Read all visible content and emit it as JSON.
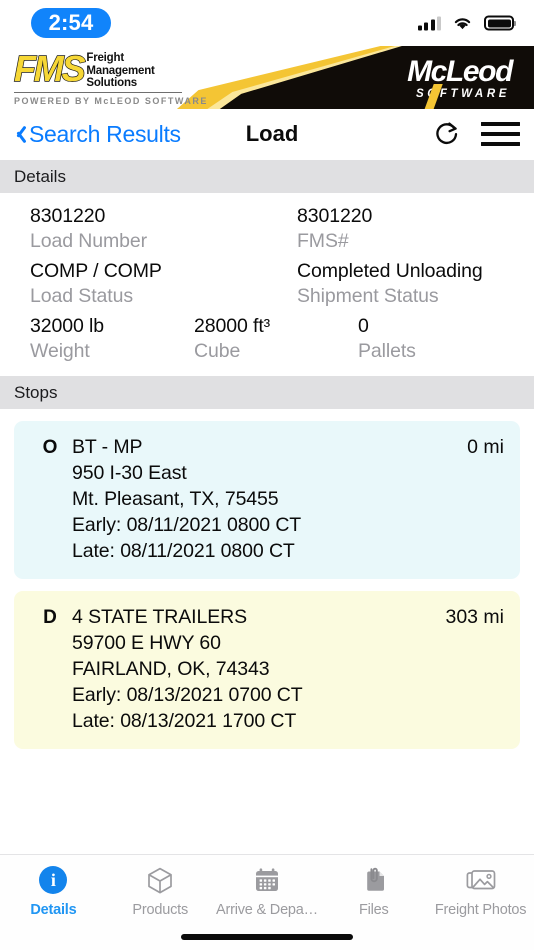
{
  "status_bar": {
    "time": "2:54",
    "time_pill_color": "#1184fb",
    "signal_icon": "cellular-signal-icon",
    "wifi_icon": "wifi-icon",
    "battery_icon": "battery-full-icon"
  },
  "brand_banner": {
    "fms_word": "FMS",
    "fms_line1": "Freight",
    "fms_line2": "Management",
    "fms_line3": "Solutions",
    "powered_by": "POWERED BY McLEOD SOFTWARE",
    "mcleod_name": "McLeod",
    "mcleod_sub": "SOFTWARE",
    "accent_yellow": "#f4c534",
    "banner_black": "#100c08"
  },
  "navbar": {
    "back_label": "Search Results",
    "back_icon": "chevron-left-icon",
    "title": "Load",
    "refresh_icon": "refresh-icon",
    "menu_icon": "hamburger-menu-icon",
    "link_color": "#0a7cff"
  },
  "details": {
    "section_title": "Details",
    "fields": [
      {
        "value": "8301220",
        "label": "Load Number"
      },
      {
        "value": "8301220",
        "label": "FMS#"
      },
      {
        "value": "COMP / COMP",
        "label": "Load Status"
      },
      {
        "value": "Completed Unloading",
        "label": "Shipment Status"
      },
      {
        "value": "32000 lb",
        "label": "Weight"
      },
      {
        "value": "28000 ft³",
        "label": "Cube"
      },
      {
        "value": "0",
        "label": "Pallets"
      }
    ]
  },
  "stops": {
    "section_title": "Stops",
    "items": [
      {
        "marker": "O",
        "type": "origin",
        "name": "BT - MP",
        "address": "950 I-30 East",
        "city_state_zip": "Mt. Pleasant, TX, 75455",
        "early": "Early: 08/11/2021 0800 CT",
        "late": "Late: 08/11/2021 0800 CT",
        "miles": "0 mi",
        "bg_color": "#e9f8fa"
      },
      {
        "marker": "D",
        "type": "destination",
        "name": "4 STATE TRAILERS",
        "address": "59700 E HWY 60",
        "city_state_zip": "FAIRLAND, OK, 74343",
        "early": "Early: 08/13/2021 0700 CT",
        "late": "Late: 08/13/2021 1700 CT",
        "miles": "303 mi",
        "bg_color": "#fbfbdf"
      }
    ]
  },
  "tabbar": {
    "active_color": "#2196f3",
    "inactive_color": "#9b9b9f",
    "tabs": [
      {
        "label": "Details",
        "icon": "info-circle-icon",
        "active": true
      },
      {
        "label": "Products",
        "icon": "cube-icon",
        "active": false
      },
      {
        "label": "Arrive & Depa…",
        "icon": "calendar-icon",
        "active": false
      },
      {
        "label": "Files",
        "icon": "file-attachment-icon",
        "active": false
      },
      {
        "label": "Freight Photos",
        "icon": "photos-icon",
        "active": false
      }
    ]
  }
}
